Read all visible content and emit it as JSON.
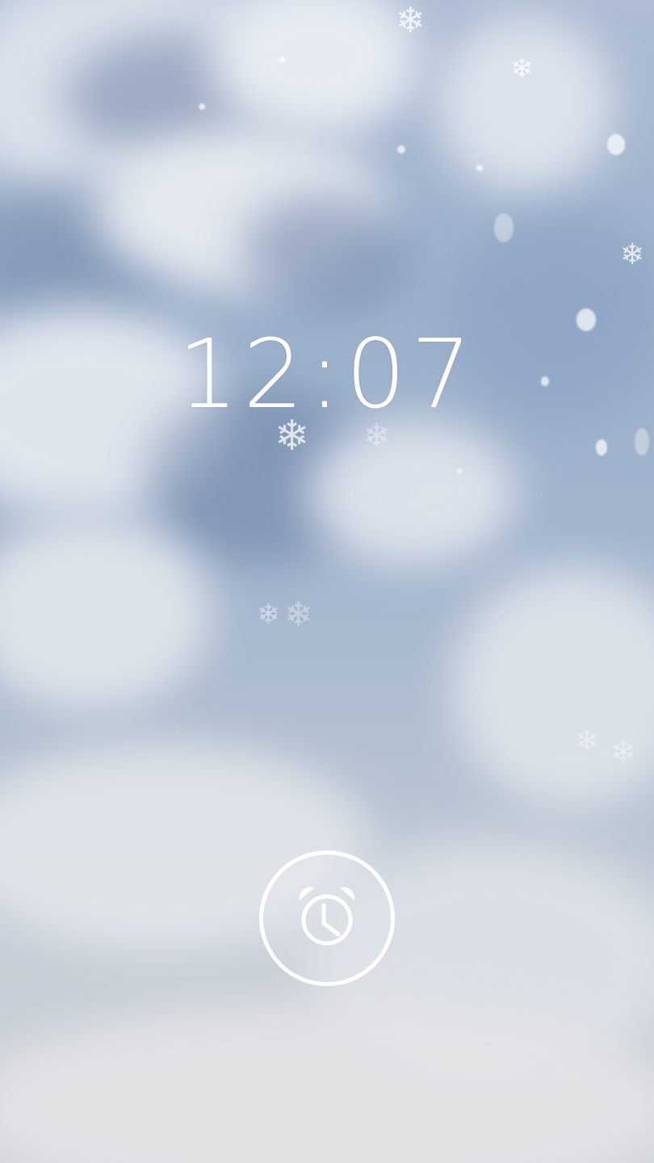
{
  "lockscreen": {
    "time": "12:07",
    "alarm_icon": "alarm-clock-icon",
    "wallpaper_icon": "snowflake-icon"
  },
  "colors": {
    "text": "#ffffff",
    "sky": "#9cb0cb",
    "snow": "#d0d4d9"
  }
}
